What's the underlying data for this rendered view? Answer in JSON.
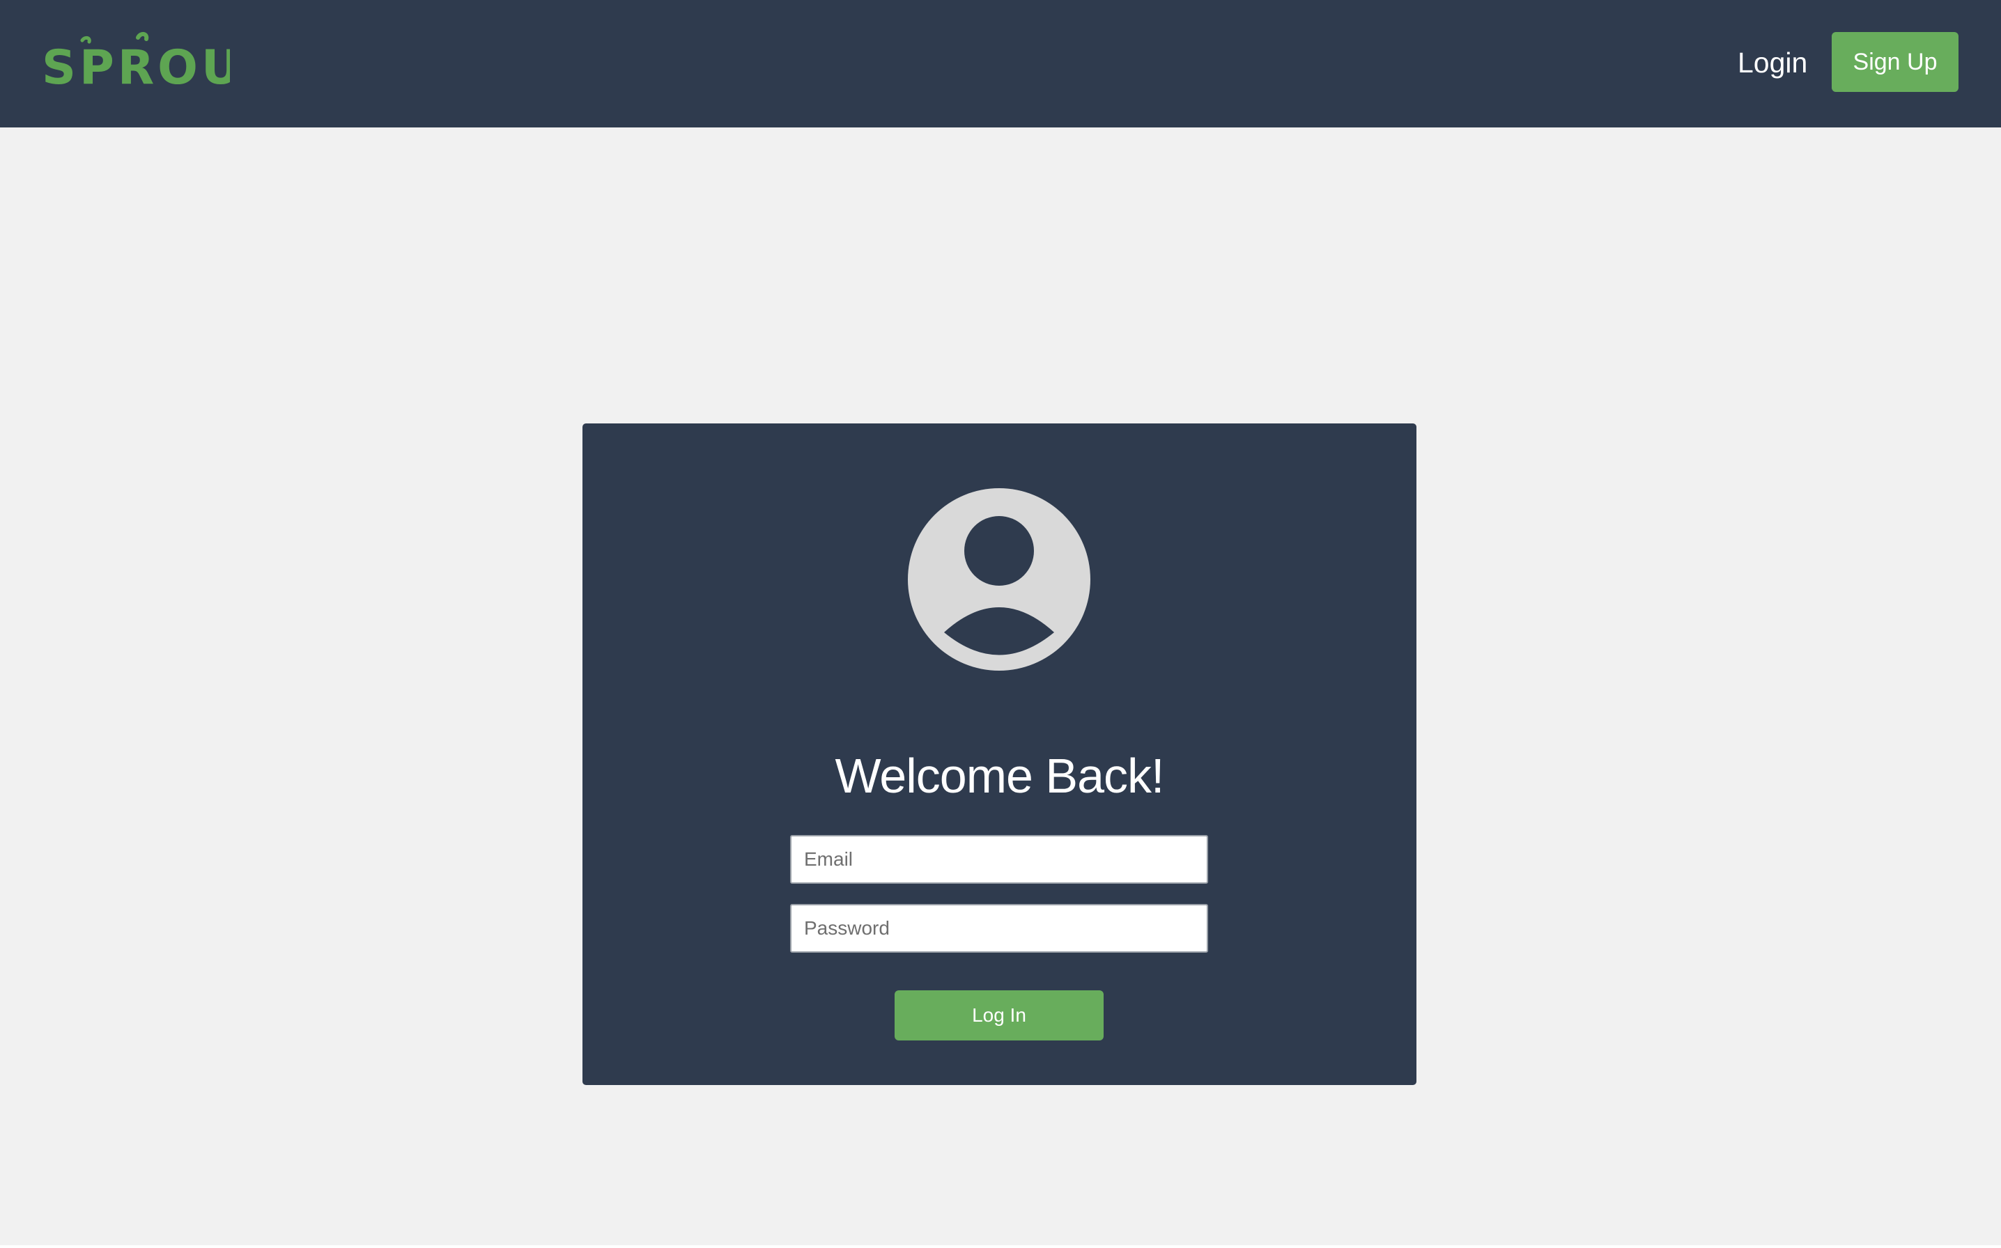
{
  "navbar": {
    "logo_text": "SPROUT",
    "login_link": "Login",
    "signup_button": "Sign Up"
  },
  "login_card": {
    "avatar_icon": "user-circle-icon",
    "heading": "Welcome Back!",
    "email_placeholder": "Email",
    "email_value": "",
    "password_placeholder": "Password",
    "password_value": "",
    "submit_label": "Log In"
  },
  "colors": {
    "navbar_bg": "#2f3b4e",
    "page_bg": "#f1f1f1",
    "accent_green": "#68ad5c",
    "logo_green": "#5ea552",
    "avatar_gray": "#d9d9d9"
  }
}
